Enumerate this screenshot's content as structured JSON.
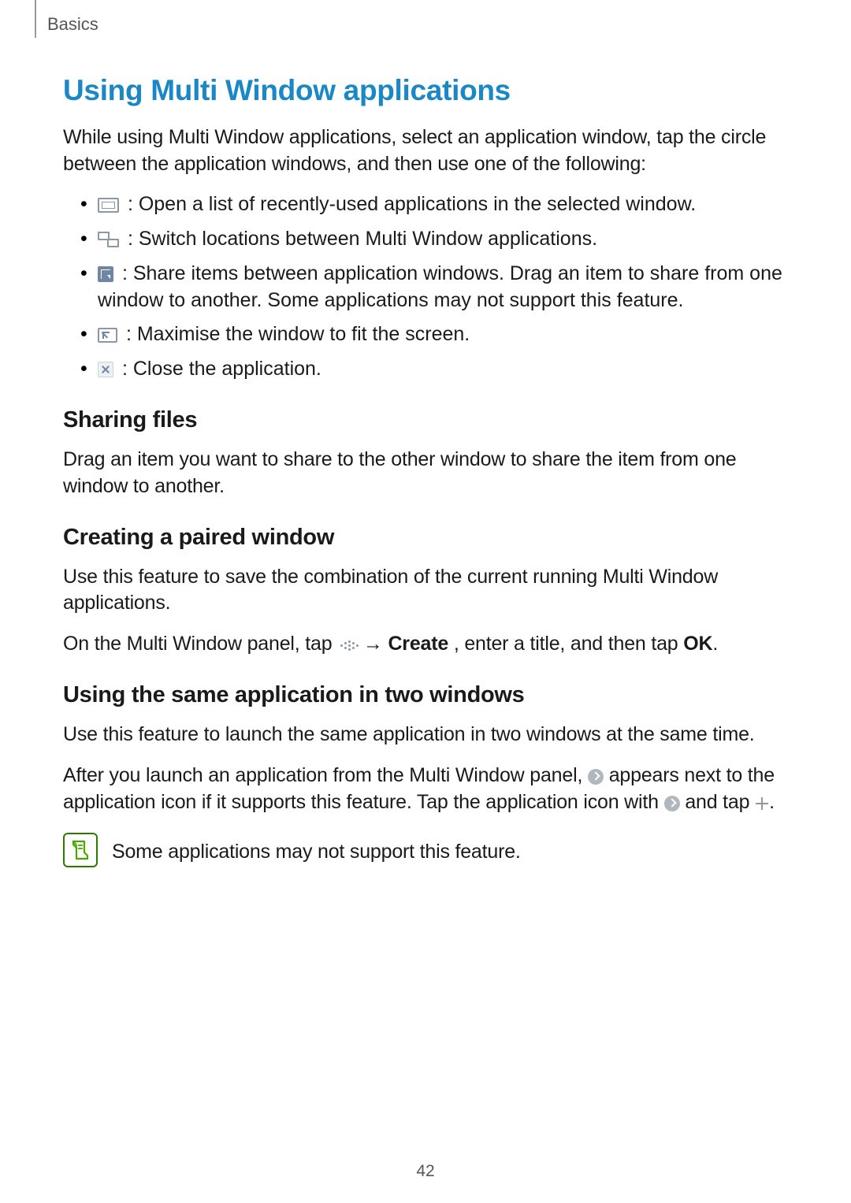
{
  "breadcrumb": "Basics",
  "heading_main": "Using Multi Window applications",
  "intro": "While using Multi Window applications, select an application window, tap the circle between the application windows, and then use one of the following:",
  "bullets": {
    "b1": " : Open a list of recently-used applications in the selected window.",
    "b2": " : Switch locations between Multi Window applications.",
    "b3": " : Share items between application windows. Drag an item to share from one window to another. Some applications may not support this feature.",
    "b4": " : Maximise the window to fit the screen.",
    "b5": " : Close the application."
  },
  "section_sharing": {
    "heading": "Sharing files",
    "body": "Drag an item you want to share to the other window to share the item from one window to another."
  },
  "section_paired": {
    "heading": "Creating a paired window",
    "body1": "Use this feature to save the combination of the current running Multi Window applications.",
    "body2_pre": "On the Multi Window panel, tap ",
    "body2_arrow": " → ",
    "body2_create": "Create",
    "body2_mid": ", enter a title, and then tap ",
    "body2_ok": "OK",
    "body2_end": "."
  },
  "section_same": {
    "heading": "Using the same application in two windows",
    "body1": "Use this feature to launch the same application in two windows at the same time.",
    "body2_a": "After you launch an application from the Multi Window panel, ",
    "body2_b": " appears next to the application icon if it supports this feature. Tap the application icon with ",
    "body2_c": " and tap ",
    "body2_d": "."
  },
  "note": "Some applications may not support this feature.",
  "page_number": "42"
}
